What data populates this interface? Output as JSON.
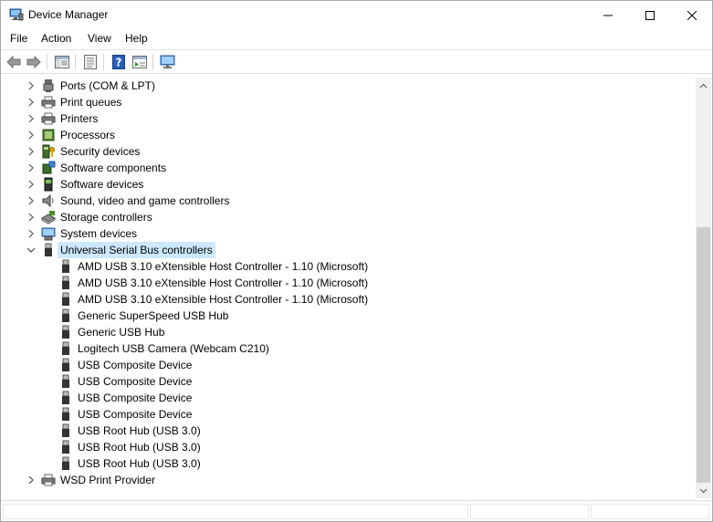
{
  "window": {
    "title": "Device Manager",
    "icon": "device-manager-icon",
    "controls": [
      "minimize-icon",
      "maximize-icon",
      "close-icon"
    ]
  },
  "menu": {
    "file": "File",
    "action": "Action",
    "view": "View",
    "help": "Help"
  },
  "toolbar": {
    "buttons": [
      "back-arrow-icon",
      "forward-arrow-icon",
      "show-hide-console-tree-icon",
      "properties-icon",
      "help-icon",
      "run-action-icon",
      "scan-hardware-icon"
    ]
  },
  "tree": {
    "categories": [
      {
        "label": "Ports (COM & LPT)",
        "icon": "port-icon",
        "expanded": false
      },
      {
        "label": "Print queues",
        "icon": "printer-icon",
        "expanded": false
      },
      {
        "label": "Printers",
        "icon": "printer-icon",
        "expanded": false
      },
      {
        "label": "Processors",
        "icon": "chip-icon",
        "expanded": false
      },
      {
        "label": "Security devices",
        "icon": "security-device-icon",
        "expanded": false
      },
      {
        "label": "Software components",
        "icon": "software-component-icon",
        "expanded": false
      },
      {
        "label": "Software devices",
        "icon": "software-device-icon",
        "expanded": false
      },
      {
        "label": "Sound, video and game controllers",
        "icon": "speaker-icon",
        "expanded": false
      },
      {
        "label": "Storage controllers",
        "icon": "storage-controller-icon",
        "expanded": false
      },
      {
        "label": "System devices",
        "icon": "system-device-icon",
        "expanded": false
      },
      {
        "label": "Universal Serial Bus controllers",
        "icon": "usb-icon",
        "expanded": true,
        "selected": true
      },
      {
        "label": "WSD Print Provider",
        "icon": "printer-icon",
        "expanded": false
      }
    ],
    "usb_children": [
      "AMD USB 3.10 eXtensible Host Controller - 1.10 (Microsoft)",
      "AMD USB 3.10 eXtensible Host Controller - 1.10 (Microsoft)",
      "AMD USB 3.10 eXtensible Host Controller - 1.10 (Microsoft)",
      "Generic SuperSpeed USB Hub",
      "Generic USB Hub",
      "Logitech USB Camera (Webcam C210)",
      "USB Composite Device",
      "USB Composite Device",
      "USB Composite Device",
      "USB Composite Device",
      "USB Root Hub (USB 3.0)",
      "USB Root Hub (USB 3.0)",
      "USB Root Hub (USB 3.0)"
    ]
  },
  "colors": {
    "selection": "#cce8ff",
    "scroll_thumb": "#cdcdcd"
  }
}
